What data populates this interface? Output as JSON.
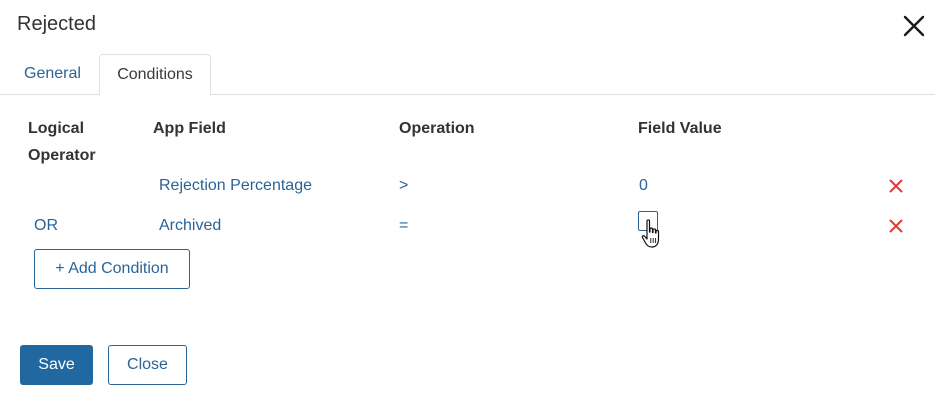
{
  "dialog": {
    "title": "Rejected"
  },
  "tabs": [
    {
      "label": "General",
      "active": false
    },
    {
      "label": "Conditions",
      "active": true
    }
  ],
  "table": {
    "headers": {
      "logical_operator": "Logical Operator",
      "app_field": "App Field",
      "operation": "Operation",
      "field_value": "Field Value"
    },
    "rows": [
      {
        "logical_operator": "",
        "app_field": "Rejection Percentage",
        "operation": ">",
        "field_value": "0",
        "value_type": "text"
      },
      {
        "logical_operator": "OR",
        "app_field": "Archived",
        "operation": "=",
        "field_value": "",
        "value_type": "checkbox",
        "checked": false
      }
    ]
  },
  "buttons": {
    "add_condition": "+ Add Condition",
    "save": "Save",
    "close": "Close"
  },
  "icons": {
    "dialog_close": "close-icon",
    "row_delete": "delete-icon",
    "pointer": "hand-cursor-icon"
  },
  "colors": {
    "accent": "#2a6496",
    "primary_button": "#2268a0",
    "delete": "#e53935",
    "border": "#e0e0e0"
  }
}
